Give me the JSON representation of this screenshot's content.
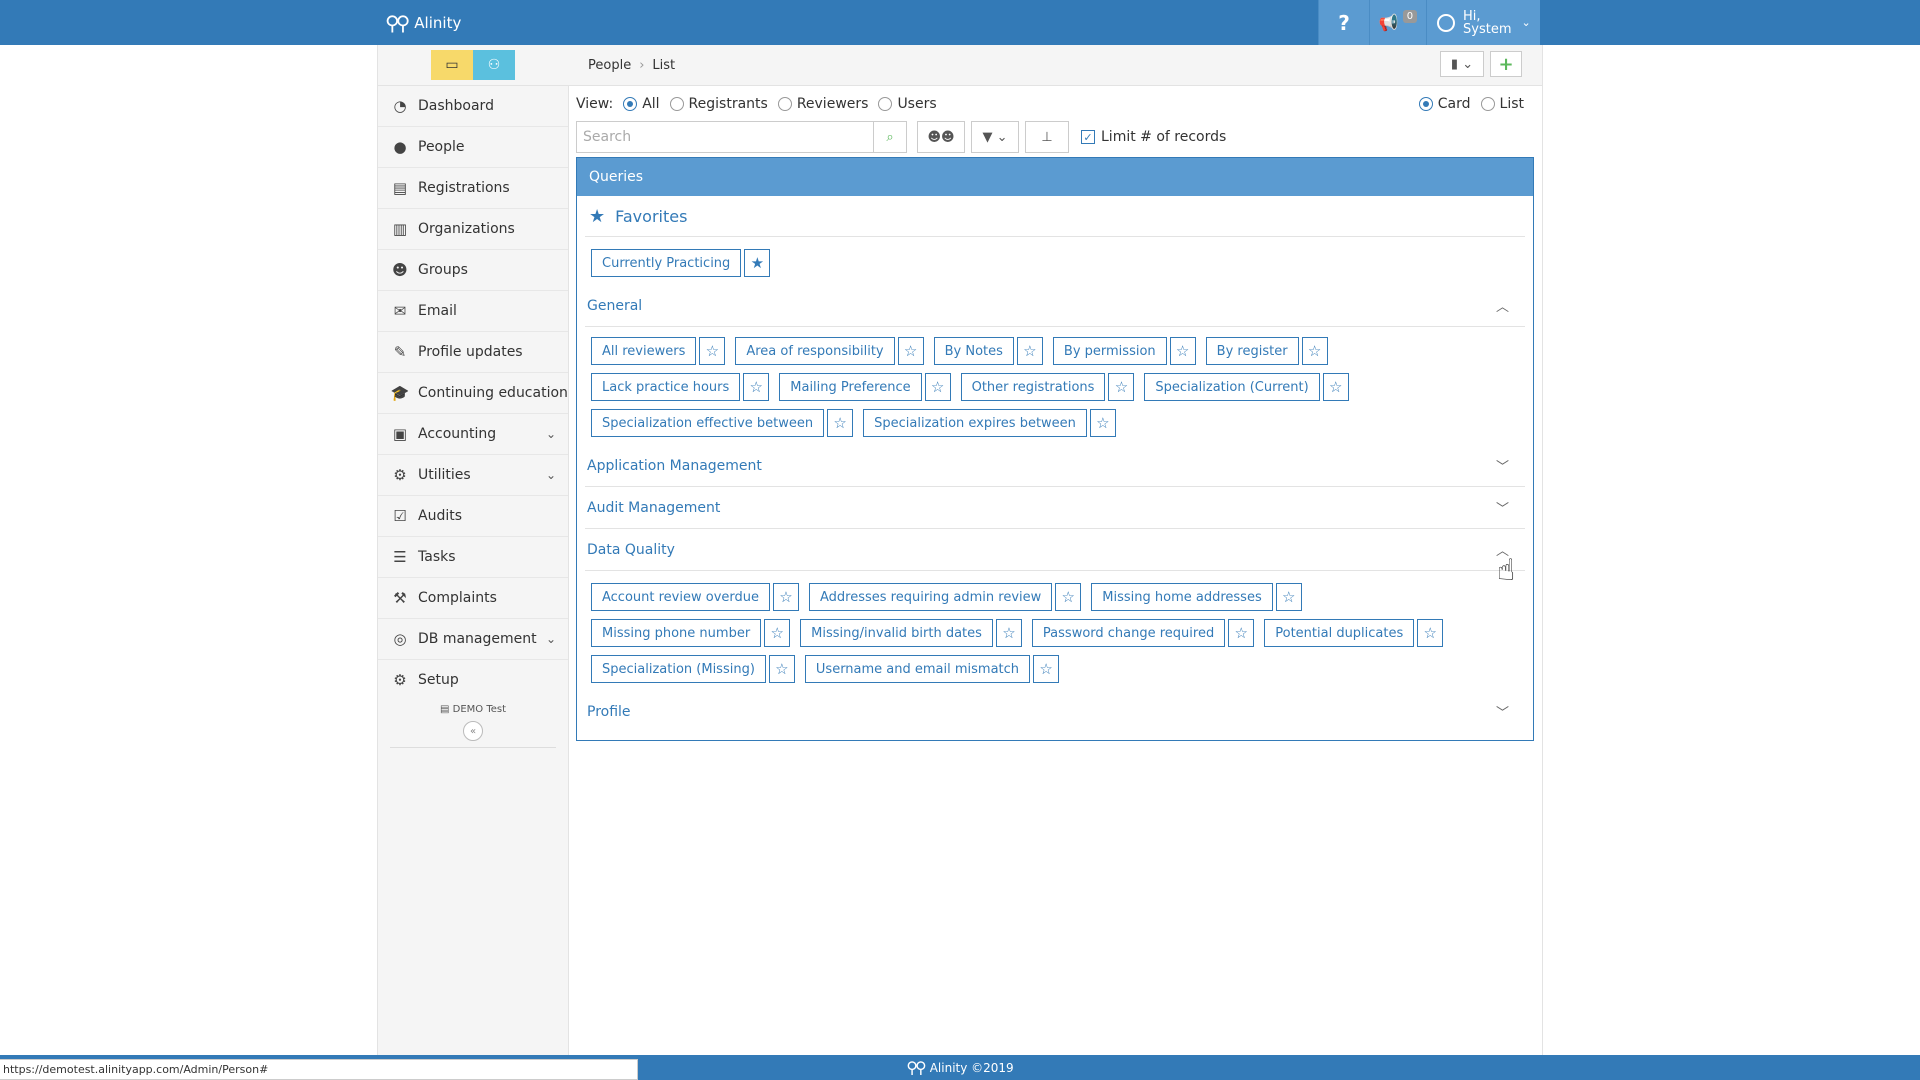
{
  "app": {
    "name": "Alinity"
  },
  "topbar": {
    "help": "?",
    "notif_count": "0",
    "user_greeting": "Hi,",
    "user_name": "System"
  },
  "sidebar": {
    "items": [
      {
        "label": "Dashboard",
        "icon": "dashboard-icon"
      },
      {
        "label": "People",
        "icon": "person-icon"
      },
      {
        "label": "Registrations",
        "icon": "id-card-icon"
      },
      {
        "label": "Organizations",
        "icon": "building-icon"
      },
      {
        "label": "Groups",
        "icon": "users-icon"
      },
      {
        "label": "Email",
        "icon": "envelope-icon"
      },
      {
        "label": "Profile updates",
        "icon": "edit-icon"
      },
      {
        "label": "Continuing education",
        "icon": "graduation-cap-icon"
      },
      {
        "label": "Accounting",
        "icon": "money-icon"
      },
      {
        "label": "Utilities",
        "icon": "gears-icon"
      },
      {
        "label": "Audits",
        "icon": "check-square-icon"
      },
      {
        "label": "Tasks",
        "icon": "list-icon"
      },
      {
        "label": "Complaints",
        "icon": "gavel-icon"
      },
      {
        "label": "DB management",
        "icon": "database-icon"
      },
      {
        "label": "Setup",
        "icon": "gear-icon"
      }
    ],
    "env_label": "DEMO Test",
    "collapse": "«"
  },
  "breadcrumb": {
    "root": "People",
    "current": "List"
  },
  "view": {
    "label": "View:",
    "options": [
      "All",
      "Registrants",
      "Reviewers",
      "Users"
    ],
    "layout_options": [
      "Card",
      "List"
    ]
  },
  "search": {
    "placeholder": "Search",
    "limit_label": "Limit # of records"
  },
  "queries": {
    "title": "Queries",
    "favorites_title": "Favorites",
    "favorites": [
      "Currently Practicing"
    ],
    "sections": {
      "general": "General",
      "application": "Application Management",
      "audit": "Audit Management",
      "data_quality": "Data Quality",
      "profile": "Profile"
    },
    "general_items": [
      "All reviewers",
      "Area of responsibility",
      "By Notes",
      "By permission",
      "By register",
      "Lack practice hours",
      "Mailing Preference",
      "Other registrations",
      "Specialization (Current)",
      "Specialization effective between",
      "Specialization expires between"
    ],
    "data_quality_items": [
      "Account review overdue",
      "Addresses requiring admin review",
      "Missing home addresses",
      "Missing phone number",
      "Missing/invalid birth dates",
      "Password change required",
      "Potential duplicates",
      "Specialization (Missing)",
      "Username and email mismatch"
    ]
  },
  "footer": {
    "text": "Alinity ©2019"
  },
  "status_bar": {
    "url": "https://demotest.alinityapp.com/Admin/Person#"
  }
}
